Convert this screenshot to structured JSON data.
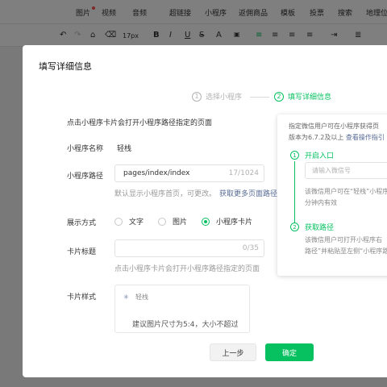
{
  "editor": {
    "menu": [
      "图片",
      "视频",
      "音频",
      "超链接",
      "小程序",
      "返佣商品",
      "模板",
      "投票",
      "搜索",
      "地理位"
    ],
    "font_size": "17px",
    "toolbar_icons": [
      "undo-icon",
      "redo-icon",
      "format-painter-icon",
      "eraser-icon",
      "bold-icon",
      "italic-icon",
      "underline-icon",
      "strikethrough-icon",
      "font-color-icon",
      "background-color-icon",
      "align-left-icon",
      "align-center-icon",
      "align-right-icon",
      "justify-icon",
      "indent-icon"
    ]
  },
  "dialog": {
    "title": "填写详细信息",
    "steps": [
      {
        "num": "1",
        "label": "选择小程序"
      },
      {
        "num": "2",
        "label": "填写详细信息"
      }
    ],
    "intro": "点击小程序卡片会打开小程序路径指定的页面",
    "mini_program": {
      "label": "小程序名称",
      "value": "轻栈"
    },
    "path": {
      "label": "小程序路径",
      "value": "pages/index/index",
      "count": "17/1024",
      "hint": "默认显示小程序首页，可更改。",
      "hint_link": "获取更多页面路径"
    },
    "display": {
      "label": "展示方式",
      "options": [
        "文字",
        "图片",
        "小程序卡片"
      ],
      "selected": "小程序卡片"
    },
    "card_title": {
      "label": "卡片标题",
      "value": "",
      "count": "0/35",
      "hint": "点击小程序卡片会打开小程序路径指定的页面"
    },
    "card_style": {
      "label": "卡片样式",
      "brand": "轻栈",
      "desc": "建议图片尺寸为5:4，大小不超过"
    },
    "buttons": {
      "prev": "上一步",
      "ok": "确定"
    }
  },
  "guide": {
    "line1": "指定微信用户可在小程序获得页",
    "line2_text": "版本为6.7.2及以上",
    "line2_link": "查看操作指引",
    "step1": {
      "num": "1",
      "title": "开启入口",
      "placeholder": "请输入微信号",
      "desc1": "该微信用户可在“轻栈”小程序",
      "desc2": "分钟内有效"
    },
    "step2": {
      "num": "2",
      "title": "获取路径",
      "desc1": "该微信用户可打开小程序右",
      "desc2": "路径”并粘贴至左侧“小程序路"
    }
  },
  "colors": {
    "accent": "#07c160",
    "link": "#576b95",
    "muted": "#999999",
    "danger": "#fa5151"
  }
}
